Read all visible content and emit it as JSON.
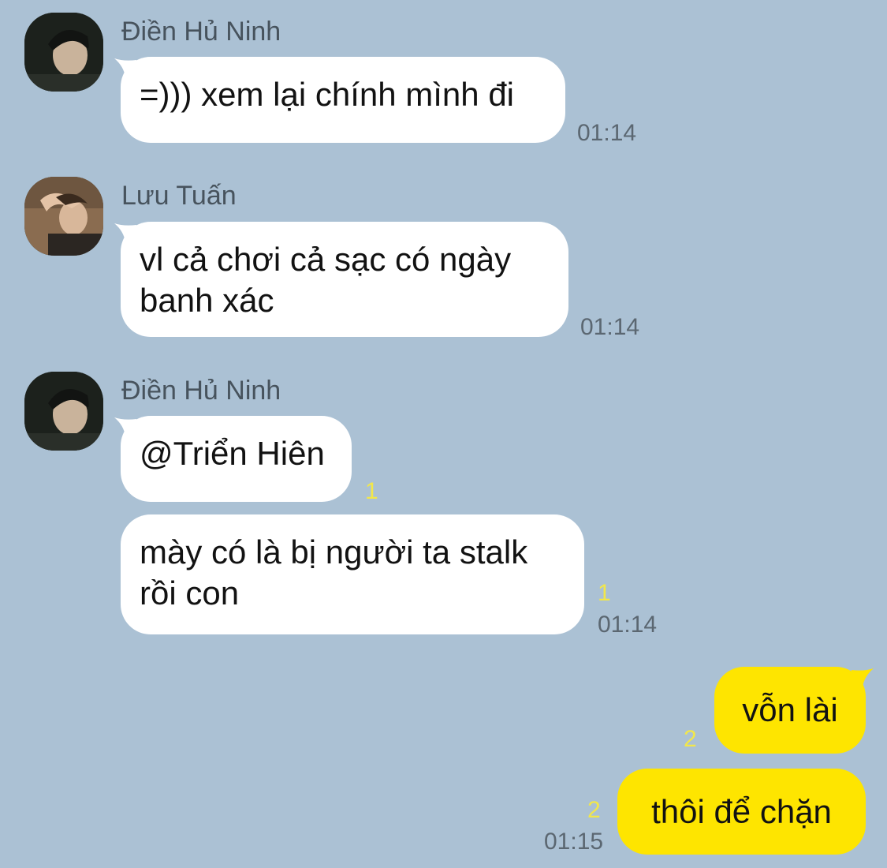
{
  "colors": {
    "background": "#abc1d4",
    "incoming_bubble": "#ffffff",
    "outgoing_bubble": "#fee500",
    "unread_count": "#f2e74a",
    "timestamp": "#5b6771",
    "sender_name": "#47535d"
  },
  "messages": [
    {
      "sender": "Điền Hủ Ninh",
      "lines": [
        "=))) xem lại chính mình đi"
      ],
      "time": "01:14"
    },
    {
      "sender": "Lưu Tuấn",
      "lines": [
        "vl cả chơi cả sạc có ngày",
        "banh xác"
      ],
      "time": "01:14"
    },
    {
      "sender": "Điền Hủ Ninh",
      "lines": [
        "@Triển Hiên"
      ],
      "unread": "1"
    },
    {
      "lines": [
        "mày có là bị người ta stalk",
        "rồi con"
      ],
      "unread": "1",
      "time": "01:14"
    },
    {
      "lines": [
        "vỗn lài"
      ],
      "unread": "2",
      "outgoing": true
    },
    {
      "lines": [
        "thôi để chặn"
      ],
      "unread": "2",
      "time": "01:15",
      "outgoing": true
    }
  ]
}
